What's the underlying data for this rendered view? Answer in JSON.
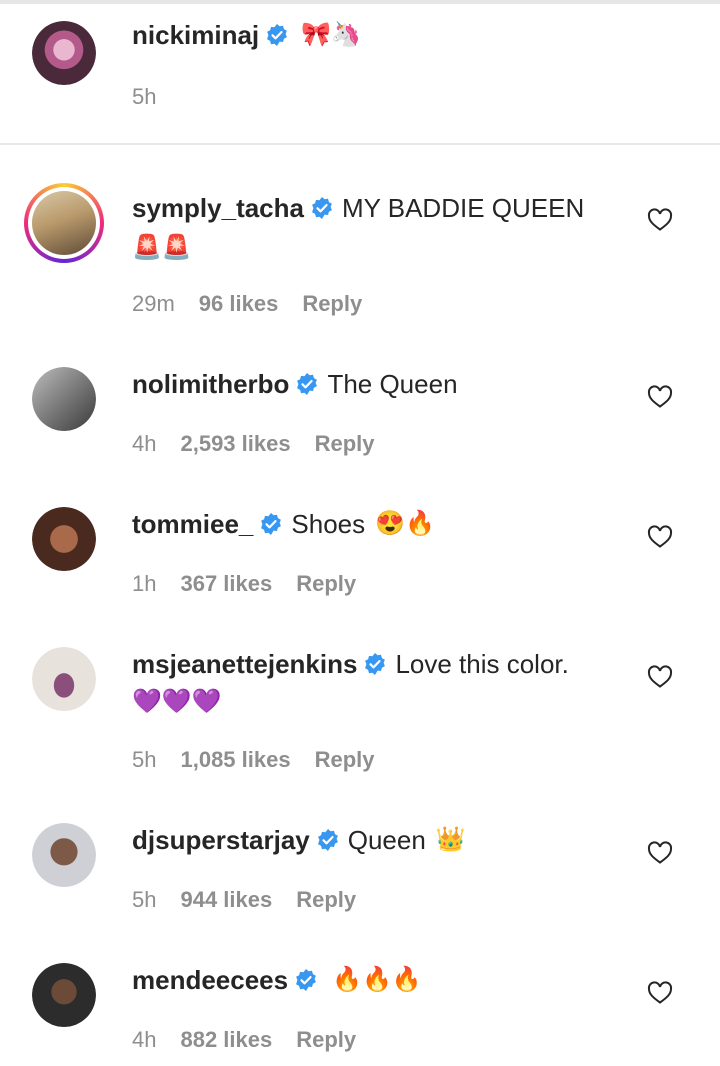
{
  "caption": {
    "username": "nickiminaj",
    "emojis": "🎀🦄",
    "time": "5h"
  },
  "comments": [
    {
      "username": "symply_tacha",
      "text": "MY BADDIE QUEEN",
      "emoji_line": "🚨🚨",
      "time": "29m",
      "likes": "96 likes",
      "reply": "Reply"
    },
    {
      "username": "nolimitherbo",
      "text": "The Queen",
      "time": "4h",
      "likes": "2,593 likes",
      "reply": "Reply"
    },
    {
      "username": "tommiee_",
      "text": "Shoes",
      "emojis": "😍🔥",
      "time": "1h",
      "likes": "367 likes",
      "reply": "Reply"
    },
    {
      "username": "msjeanettejenkins",
      "text": "Love this color.",
      "emoji_line": "💜💜💜",
      "time": "5h",
      "likes": "1,085 likes",
      "reply": "Reply"
    },
    {
      "username": "djsuperstarjay",
      "text": "Queen",
      "emojis": "👑",
      "time": "5h",
      "likes": "944 likes",
      "reply": "Reply"
    },
    {
      "username": "mendeecees",
      "text": "",
      "emojis": "🔥🔥🔥",
      "time": "4h",
      "likes": "882 likes",
      "reply": "Reply"
    }
  ],
  "colors": {
    "verified": "#3897f0",
    "muted": "#8e8e8e",
    "text": "#262626"
  },
  "icons": {
    "verified": "verified-badge-icon",
    "like": "heart-outline-icon"
  }
}
